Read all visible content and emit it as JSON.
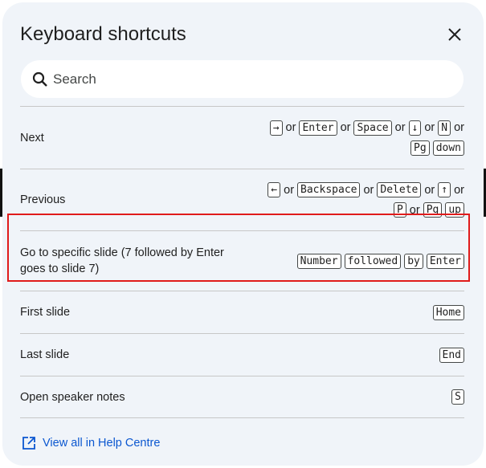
{
  "dialog": {
    "title": "Keyboard shortcuts",
    "close_icon": "close-icon"
  },
  "search": {
    "placeholder": "Search",
    "icon": "search-icon"
  },
  "shortcuts": [
    {
      "label": "Next",
      "keys_line1": [
        "→",
        "or",
        "Enter",
        "or",
        "Space",
        "or",
        "↓",
        "or",
        "N",
        "or"
      ],
      "keys_line2": [
        "Pg",
        "down"
      ]
    },
    {
      "label": "Previous",
      "keys_line1": [
        "←",
        "or",
        "Backspace",
        "or",
        "Delete",
        "or",
        "↑",
        "or"
      ],
      "keys_line2": [
        "P",
        "or",
        "Pg",
        "up"
      ]
    },
    {
      "label": "Go to specific slide (7 followed by Enter goes to slide 7)",
      "keys": [
        "Number",
        "followed",
        "by",
        "Enter"
      ]
    },
    {
      "label": "First slide",
      "keys": [
        "Home"
      ]
    },
    {
      "label": "Last slide",
      "keys": [
        "End"
      ]
    },
    {
      "label": "Open speaker notes",
      "keys": [
        "S"
      ]
    }
  ],
  "footer": {
    "link_label": "View all in Help Centre",
    "icon": "open-in-new-icon"
  },
  "colors": {
    "dialog_bg": "#f0f4f9",
    "link": "#0b57d0",
    "highlight": "#e01b1b"
  }
}
